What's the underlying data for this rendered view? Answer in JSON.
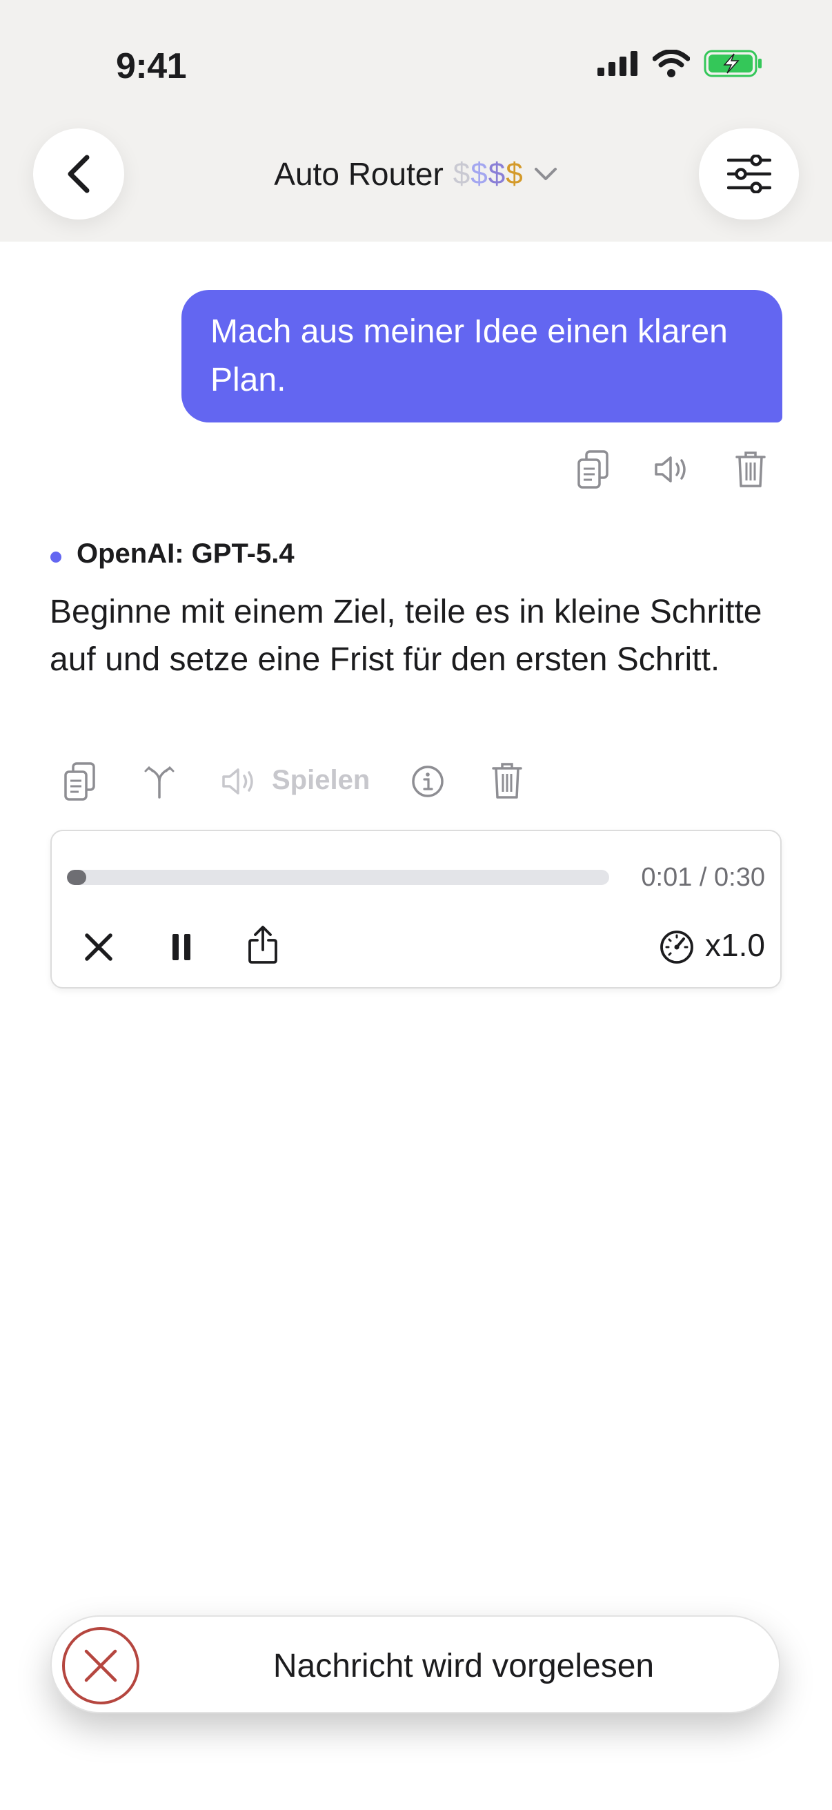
{
  "status_bar": {
    "time": "9:41"
  },
  "header": {
    "title": "Auto Router",
    "price": [
      "$",
      "$",
      "$",
      "$"
    ]
  },
  "user_message": {
    "text": "Mach aus meiner Idee einen klaren Plan."
  },
  "assistant": {
    "model": "OpenAI: GPT-5.4",
    "text": "Beginne mit einem Ziel, teile es in kleine Schritte auf und setze eine Frist für den ersten Schritt.",
    "play_label": "Spielen"
  },
  "audio_player": {
    "time": "0:01 / 0:30",
    "progress": 0.035,
    "speed": "x1.0"
  },
  "toast": {
    "text": "Nachricht wird vorgelesen"
  },
  "colors": {
    "accent": "#6366f1",
    "toast_icon": "#b5463f",
    "header_bg": "#f2f1ef"
  }
}
